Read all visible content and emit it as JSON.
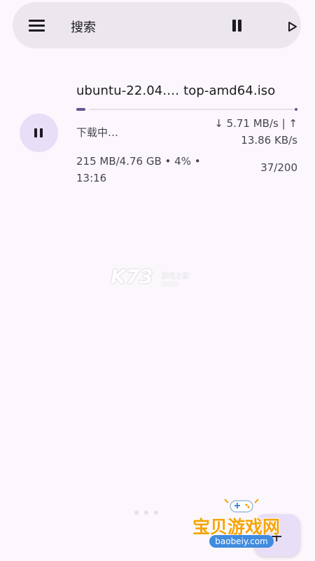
{
  "search_bar": {
    "placeholder": "搜索",
    "menu_icon": "menu-icon",
    "pause_all_icon": "pause-icon",
    "resume_all_icon": "play-icon"
  },
  "torrent": {
    "name": "ubuntu-22.04.… top-amd64.iso",
    "progress": 0.04,
    "status": "下载中…",
    "speed_line1": "↓ 5.71 MB/s | ↑",
    "speed_line2": "13.86 KB/s",
    "details_line1": "215 MB/4.76 GB  •  4%  •",
    "details_line2": "13:16",
    "pieces": "37/200",
    "pause_icon": "pause-icon"
  },
  "watermark": {
    "brand": "K73",
    "cn_text": "游戏之家",
    "domain": ".com"
  },
  "fab": {
    "icon": "plus-icon",
    "label": "+"
  },
  "logo": {
    "title": "宝贝游戏网",
    "domain": "baobeiy.com"
  },
  "colors": {
    "background": "#fcf7fd",
    "surface": "#ece6ee",
    "accent": "#6a558f",
    "tonal": "#e8def8"
  }
}
